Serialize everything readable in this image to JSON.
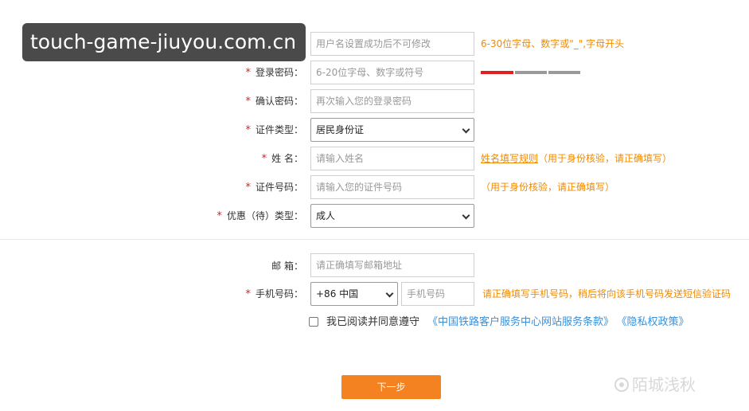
{
  "watermark_top": "touch-game-jiuyou.com.cn",
  "username": {
    "placeholder": "用户名设置成功后不可修改",
    "hint": "6-30位字母、数字或\"_\",字母开头"
  },
  "password": {
    "label": "登录密码：",
    "placeholder": "6-20位字母、数字或符号",
    "strength_level": 1,
    "strength_levels": 3
  },
  "confirm_password": {
    "label": "确认密码：",
    "placeholder": "再次输入您的登录密码"
  },
  "id_type": {
    "label": "证件类型：",
    "value": "居民身份证"
  },
  "name": {
    "label": "姓 名：",
    "placeholder": "请输入姓名",
    "hint_link": "姓名填写规则",
    "hint": "（用于身份核验，请正确填写）"
  },
  "id_number": {
    "label": "证件号码：",
    "placeholder": "请输入您的证件号码",
    "hint": "（用于身份核验，请正确填写）"
  },
  "discount_type": {
    "label": "优惠（待）类型：",
    "value": "成人"
  },
  "email": {
    "label": "邮 箱：",
    "placeholder": "请正确填写邮箱地址"
  },
  "phone": {
    "label": "手机号码：",
    "country_code": "+86 中国",
    "placeholder": "手机号码",
    "hint": "请正确填写手机号码，稍后将向该手机号码发送短信验证码"
  },
  "agreement": {
    "text": "我已阅读并同意遵守",
    "terms_link": "《中国铁路客户服务中心网站服务条款》",
    "privacy_link": "《隐私权政策》"
  },
  "next_button": "下一步",
  "watermark_bottom": "陌城浅秋",
  "colors": {
    "required_star": "#e02020",
    "hint": "#f08a00",
    "link": "#3b8fd8",
    "button": "#f58220"
  }
}
